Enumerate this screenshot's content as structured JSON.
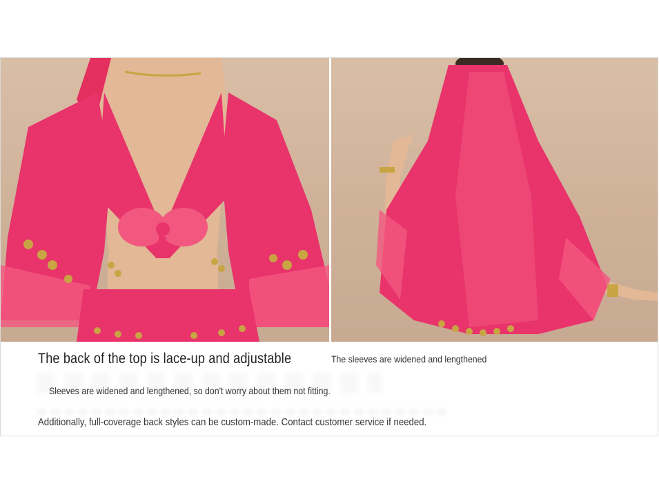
{
  "images": {
    "left": {
      "subject": "back view of rose-pink top with lace-up bow"
    },
    "right": {
      "subject": "back view of rose-pink veil and sleeves"
    }
  },
  "captions": {
    "title": "The back of the top is lace-up and adjustable",
    "side_note": "The sleeves are widened and lengthened",
    "line1": "Sleeves are widened and lengthened, so don't worry about them not fitting.",
    "line2": "Additionally, full-coverage back styles can be custom-made. Contact customer service if needed."
  },
  "colors": {
    "fabric": "#e8336b",
    "fabric_light": "#f2577f",
    "backdrop": "#d2b49c",
    "skin": "#e2b896",
    "coin": "#c9a443"
  }
}
